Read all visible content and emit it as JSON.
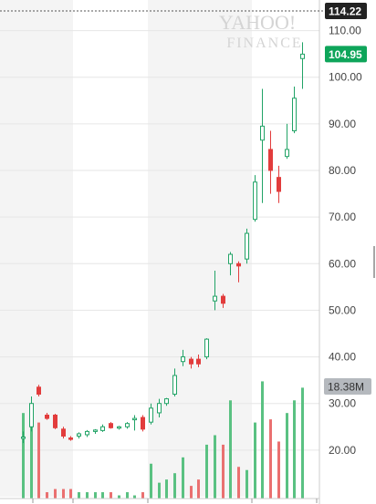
{
  "watermark": {
    "line1": "YAHOO!",
    "line2": "FINANCE"
  },
  "chart_data": {
    "type": "candlestick",
    "ylim": [
      10,
      115
    ],
    "yticks": [
      20,
      30,
      40,
      50,
      60,
      70,
      80,
      90,
      100,
      110
    ],
    "ytick_labels": [
      "20.00",
      "30.00",
      "40.00",
      "50.00",
      "60.00",
      "70.00",
      "80.00",
      "90.00",
      "100.00",
      "110.00"
    ],
    "grid": true,
    "high_line": {
      "value": 114.22,
      "label": "114.22"
    },
    "last_price": {
      "value": 104.95,
      "label": "104.95"
    },
    "volume_label": "18.38M",
    "colors": {
      "up": "#21a366",
      "down": "#e23c3c",
      "volume_up": "#5ac182",
      "volume_down": "#ea7070",
      "badge_dark": "#222222",
      "badge_green": "#0ea55a",
      "badge_gray": "#b5b9be",
      "shade": "#f4f4f4"
    },
    "candles": [
      {
        "o": 22.5,
        "h": 24.0,
        "l": 21.5,
        "c": 22.8,
        "vol": 27
      },
      {
        "o": 25.0,
        "h": 31.5,
        "l": 24.0,
        "c": 30.0,
        "vol": 30
      },
      {
        "o": 33.5,
        "h": 34.0,
        "l": 31.5,
        "c": 32.0,
        "vol": 24
      },
      {
        "o": 27.5,
        "h": 28.0,
        "l": 26.5,
        "c": 26.8,
        "vol": 2
      },
      {
        "o": 27.5,
        "h": 27.8,
        "l": 24.5,
        "c": 24.8,
        "vol": 3
      },
      {
        "o": 24.5,
        "h": 25.0,
        "l": 22.5,
        "c": 23.0,
        "vol": 3
      },
      {
        "o": 22.6,
        "h": 23.0,
        "l": 22.0,
        "c": 22.3,
        "vol": 3
      },
      {
        "o": 23.0,
        "h": 23.8,
        "l": 22.5,
        "c": 23.5,
        "vol": 2
      },
      {
        "o": 23.3,
        "h": 24.3,
        "l": 22.8,
        "c": 24.0,
        "vol": 2
      },
      {
        "o": 24.0,
        "h": 24.5,
        "l": 23.5,
        "c": 24.3,
        "vol": 2
      },
      {
        "o": 24.2,
        "h": 25.5,
        "l": 23.9,
        "c": 25.0,
        "vol": 2
      },
      {
        "o": 25.7,
        "h": 26.0,
        "l": 24.6,
        "c": 24.8,
        "vol": 2
      },
      {
        "o": 24.8,
        "h": 25.2,
        "l": 24.4,
        "c": 25.0,
        "vol": 1
      },
      {
        "o": 25.0,
        "h": 26.0,
        "l": 24.6,
        "c": 25.7,
        "vol": 2
      },
      {
        "o": 26.5,
        "h": 27.5,
        "l": 24.2,
        "c": 26.8,
        "vol": 1
      },
      {
        "o": 27.0,
        "h": 27.5,
        "l": 24.0,
        "c": 24.5,
        "vol": 2
      },
      {
        "o": 26.0,
        "h": 30.0,
        "l": 25.5,
        "c": 29.0,
        "vol": 11
      },
      {
        "o": 28.0,
        "h": 31.0,
        "l": 27.0,
        "c": 30.0,
        "vol": 5
      },
      {
        "o": 30.0,
        "h": 31.2,
        "l": 29.5,
        "c": 31.0,
        "vol": 6
      },
      {
        "o": 32.0,
        "h": 37.5,
        "l": 31.5,
        "c": 36.0,
        "vol": 8
      },
      {
        "o": 39.0,
        "h": 41.5,
        "l": 38.0,
        "c": 40.0,
        "vol": 13
      },
      {
        "o": 39.5,
        "h": 40.0,
        "l": 37.5,
        "c": 38.5,
        "vol": 4
      },
      {
        "o": 39.5,
        "h": 40.5,
        "l": 37.8,
        "c": 38.5,
        "vol": 6
      },
      {
        "o": 40.0,
        "h": 44.0,
        "l": 39.5,
        "c": 43.8,
        "vol": 17
      },
      {
        "o": 52.0,
        "h": 58.5,
        "l": 50.0,
        "c": 53.0,
        "vol": 20
      },
      {
        "o": 53.0,
        "h": 53.5,
        "l": 50.5,
        "c": 51.5,
        "vol": 17
      },
      {
        "o": 60.0,
        "h": 62.5,
        "l": 57.5,
        "c": 62.0,
        "vol": 31
      },
      {
        "o": 60.0,
        "h": 60.5,
        "l": 56.0,
        "c": 59.5,
        "vol": 10
      },
      {
        "o": 61.0,
        "h": 67.5,
        "l": 60.0,
        "c": 66.5,
        "vol": 9
      },
      {
        "o": 69.5,
        "h": 79.0,
        "l": 69.0,
        "c": 77.5,
        "vol": 24
      },
      {
        "o": 86.5,
        "h": 97.5,
        "l": 73.0,
        "c": 89.5,
        "vol": 37
      },
      {
        "o": 84.5,
        "h": 88.5,
        "l": 75.0,
        "c": 80.0,
        "vol": 25
      },
      {
        "o": 78.5,
        "h": 81.0,
        "l": 73.0,
        "c": 75.5,
        "vol": 18
      },
      {
        "o": 83.0,
        "h": 90.0,
        "l": 82.5,
        "c": 84.5,
        "vol": 27
      },
      {
        "o": 88.5,
        "h": 98.0,
        "l": 88.0,
        "c": 95.5,
        "vol": 31
      },
      {
        "o": 104.0,
        "h": 107.5,
        "l": 97.5,
        "c": 104.95,
        "vol": 35
      }
    ],
    "volume_max": 40
  }
}
